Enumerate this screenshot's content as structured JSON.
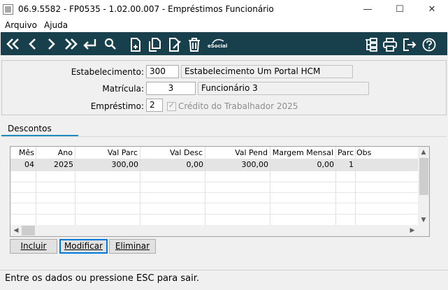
{
  "window": {
    "title": "06.9.5582 - FP0535 - 1.02.00.007 - Empréstimos Funcionário",
    "minimize_glyph": "—",
    "maximize_glyph": "☐",
    "close_glyph": "✕"
  },
  "menu": [
    "Arquivo",
    "Ajuda"
  ],
  "toolbar": {
    "bg_color": "#18404c",
    "left_icons": [
      "first-record-icon",
      "previous-record-icon",
      "next-record-icon",
      "last-record-icon",
      "return-icon",
      "search-icon",
      "new-document-icon",
      "copy-icon",
      "edit-icon",
      "delete-icon",
      "esocial-icon"
    ],
    "esocial_label": "eSocial",
    "right_icons": [
      "tree-structure-icon",
      "print-icon",
      "exit-icon",
      "help-icon"
    ]
  },
  "form": {
    "estabelecimento_label": "Estabelecimento:",
    "estabelecimento_code": "300",
    "estabelecimento_name": "Estabelecimento Um Portal HCM",
    "matricula_label": "Matrícula:",
    "matricula_code": "3",
    "matricula_name": "Funcionário 3",
    "emprestimo_label": "Empréstimo:",
    "emprestimo_value": "2",
    "credito_label": "Crédito do Trabalhador 2025",
    "credito_checked": true
  },
  "tabs": [
    {
      "label": "Descontos",
      "active": true
    }
  ],
  "grid": {
    "columns": [
      "Mês",
      "Ano",
      "Val Parc",
      "Val Desc",
      "Val Pend",
      "Margem Mensal",
      "Parc",
      "Obs"
    ],
    "rows": [
      [
        "04",
        "2025",
        "300,00",
        "0,00",
        "300,00",
        "0,00",
        "1",
        ""
      ]
    ]
  },
  "buttons": {
    "incluir": "Incluir",
    "modificar": "Modificar",
    "eliminar": "Eliminar"
  },
  "status": {
    "text": "Entre os dados ou pressione ESC para sair."
  }
}
